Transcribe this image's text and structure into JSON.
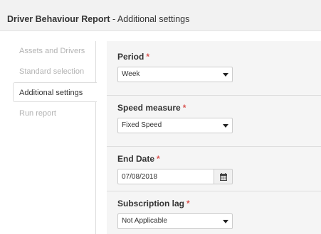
{
  "header": {
    "title_bold": "Driver Behaviour Report",
    "title_rest": " - Additional settings"
  },
  "nav": {
    "items": [
      {
        "label": "Assets and Drivers",
        "active": false
      },
      {
        "label": "Standard selection",
        "active": false
      },
      {
        "label": "Additional settings",
        "active": true
      },
      {
        "label": "Run report",
        "active": false
      }
    ]
  },
  "form": {
    "required_marker": "*",
    "period": {
      "label": "Period",
      "value": "Week"
    },
    "speed_measure": {
      "label": "Speed measure",
      "value": "Fixed Speed"
    },
    "end_date": {
      "label": "End Date",
      "value": "07/08/2018",
      "button_icon": "calendar-icon"
    },
    "subscription_lag": {
      "label": "Subscription lag",
      "value": "Not Applicable"
    }
  },
  "colors": {
    "required": "#d9534f",
    "nav_inactive": "#b3b3b3",
    "content_bg": "#f5f5f5",
    "header_bg": "#f2f2f2"
  }
}
